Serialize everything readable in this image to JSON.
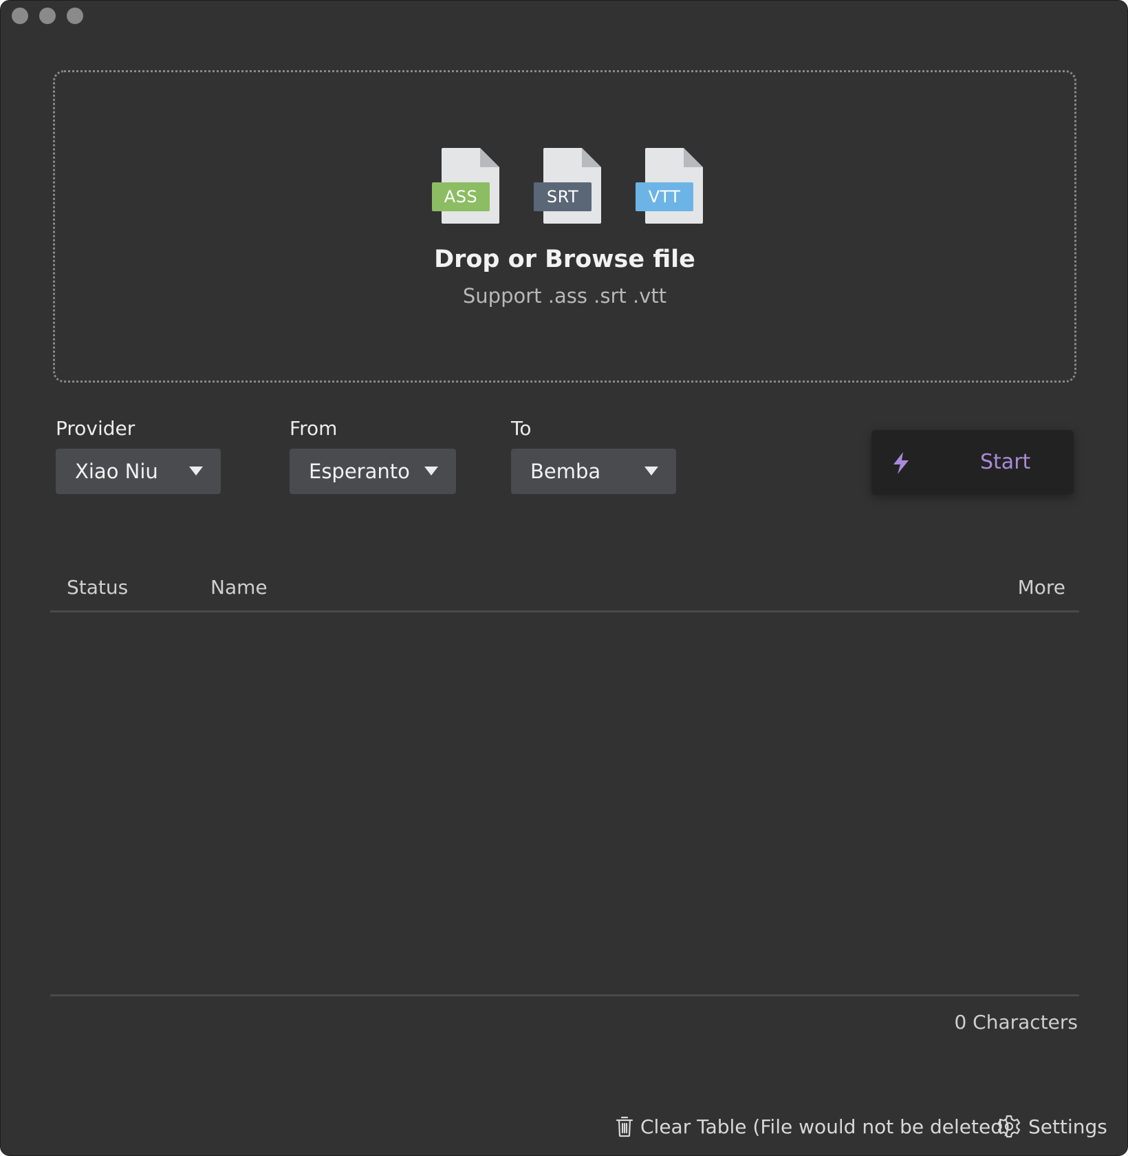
{
  "colors": {
    "window_bg": "#323232",
    "ass_tag": "#8cbd63",
    "srt_tag": "#5a6776",
    "vtt_tag": "#6cb4e6",
    "accent": "#a98ad8"
  },
  "dropzone": {
    "file_types": [
      "ASS",
      "SRT",
      "VTT"
    ],
    "title": "Drop or Browse file",
    "subtitle": "Support .ass .srt .vtt"
  },
  "controls": {
    "provider": {
      "label": "Provider",
      "value": "Xiao Niu"
    },
    "from": {
      "label": "From",
      "value": "Esperanto"
    },
    "to": {
      "label": "To",
      "value": "Bemba"
    },
    "start_label": "Start"
  },
  "table": {
    "columns": [
      "Status",
      "Name",
      "More"
    ],
    "rows": []
  },
  "footer": {
    "char_count": "0 Characters",
    "clear_label": "Clear Table (File would not be deleted)",
    "settings_label": "Settings"
  }
}
